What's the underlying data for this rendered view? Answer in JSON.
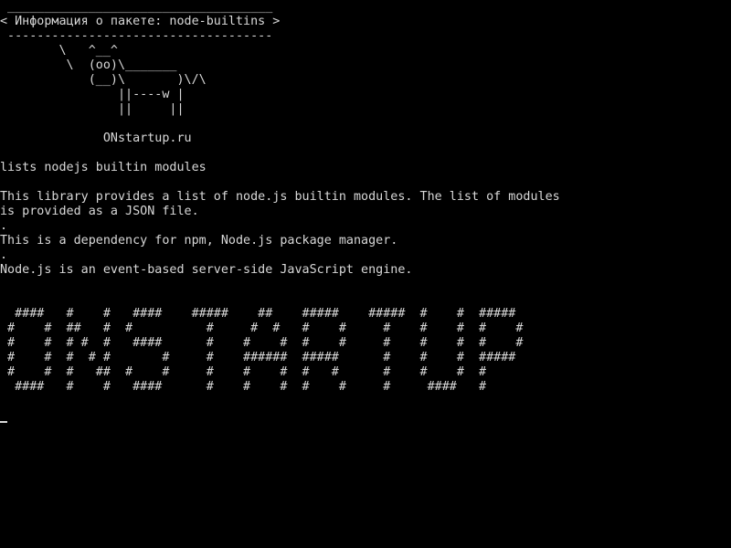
{
  "colors": {
    "background": "#000000",
    "foreground": "#d8d8d8"
  },
  "terminal": {
    "cowsay": {
      "border_top": " ____________________________________",
      "message": "< Информация о пакете: node-builtins >",
      "border_bottom": " ------------------------------------",
      "cow": [
        "        \\   ^__^",
        "         \\  (oo)\\_______",
        "            (__)\\       )\\/\\",
        "                ||----w |",
        "                ||     ||"
      ]
    },
    "site": "              ONstartup.ru",
    "summary": "lists nodejs builtin modules",
    "description": [
      "This library provides a list of node.js builtin modules. The list of modules",
      "is provided as a JSON file.",
      ".",
      "This is a dependency for npm, Node.js package manager.",
      ".",
      "Node.js is an event-based server-side JavaScript engine."
    ],
    "banner": [
      "  ####   #    #   ####    #####    ##    #####    #####  #    #  #####",
      " #    #  ##   #  #          #     #  #   #    #     #    #    #  #    #",
      " #    #  # #  #   ####      #    #    #  #    #     #    #    #  #    #",
      " #    #  #  # #       #     #    ######  #####      #    #    #  #####",
      " #    #  #   ##  #    #     #    #    #  #   #      #    #    #  #",
      "  ####   #    #   ####      #    #    #  #    #     #     ####   #"
    ]
  }
}
